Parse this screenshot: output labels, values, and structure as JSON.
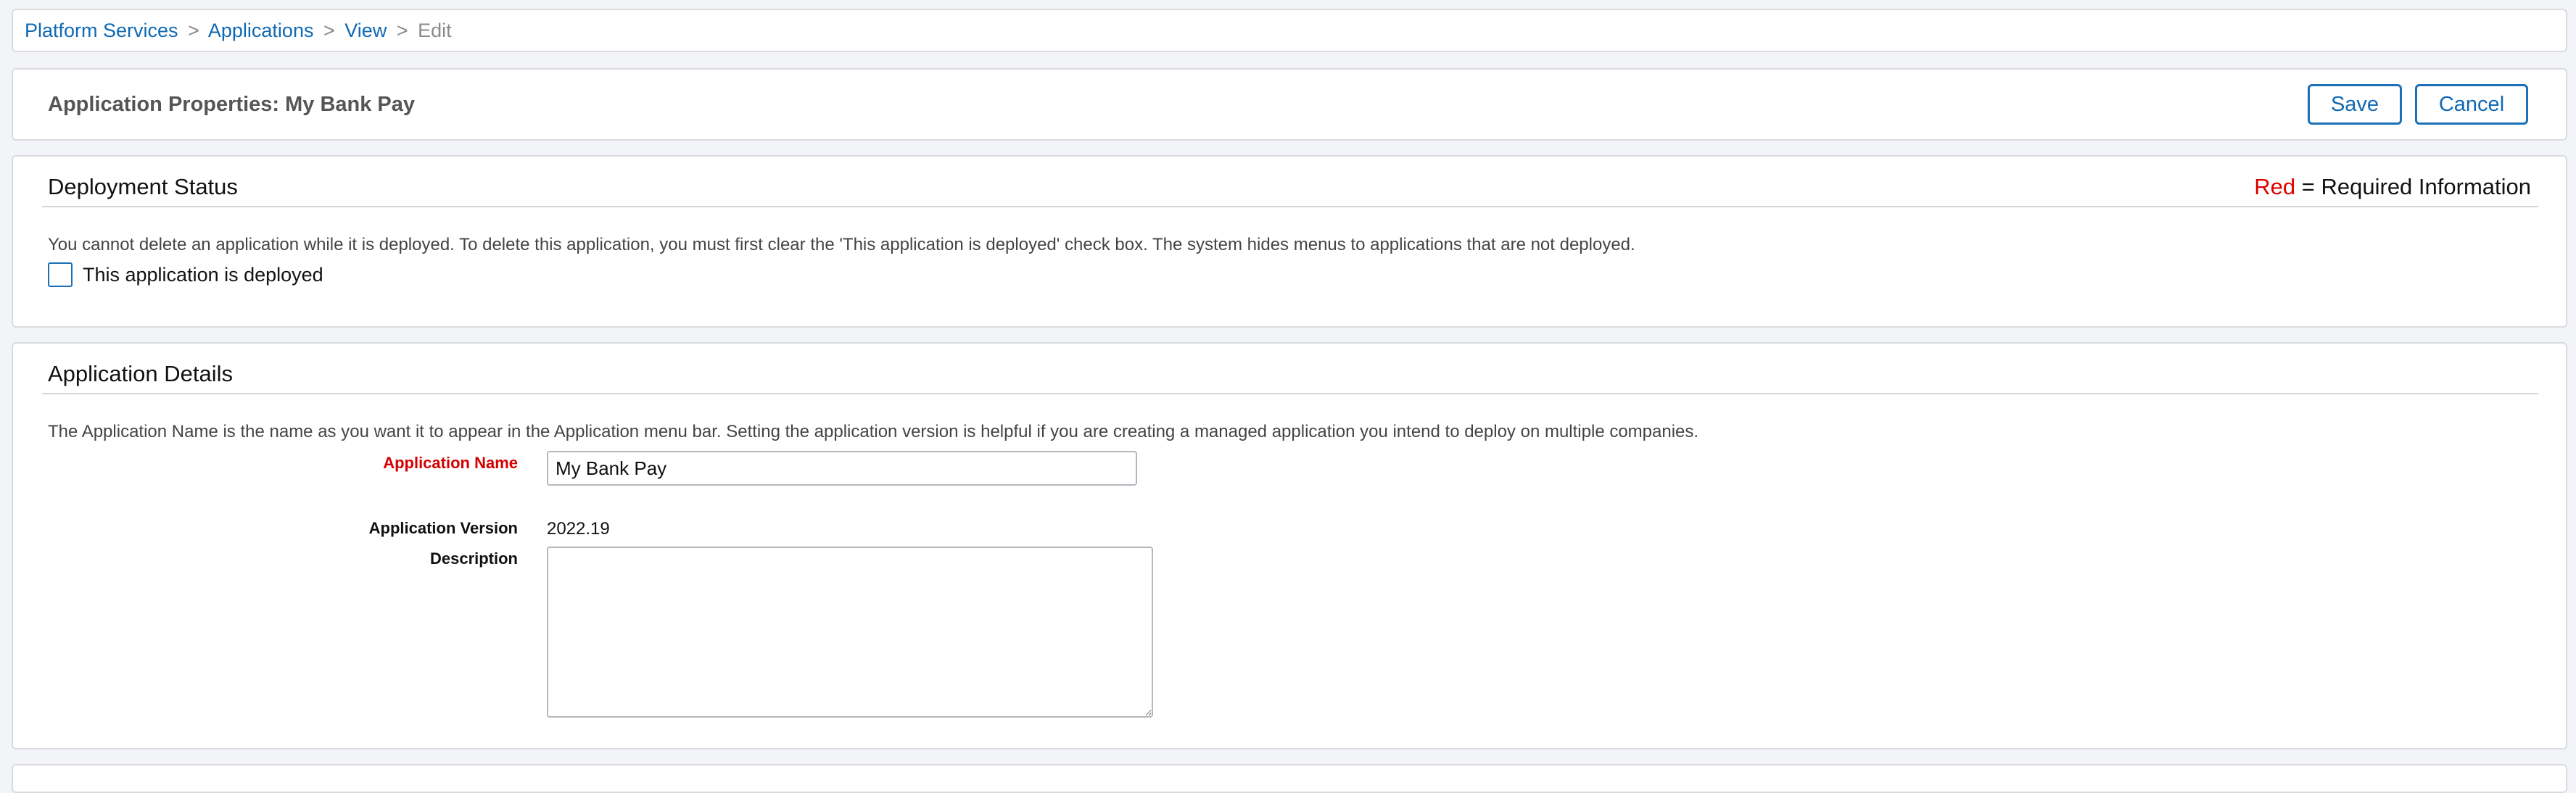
{
  "breadcrumb": {
    "items": [
      "Platform Services",
      "Applications",
      "View"
    ],
    "separator": ">",
    "current": "Edit"
  },
  "header": {
    "title": "Application Properties: My Bank Pay",
    "save_label": "Save",
    "cancel_label": "Cancel"
  },
  "deployment": {
    "title": "Deployment Status",
    "required_note_red": "Red",
    "required_note_rest": " = Required Information",
    "help_text": "You cannot delete an application while it is deployed. To delete this application, you must first clear the 'This application is deployed' check box. The system hides menus to applications that are not deployed.",
    "checkbox_label": "This application is deployed",
    "checkbox_checked": false
  },
  "details": {
    "title": "Application Details",
    "help_text": "The Application Name is the name as you want it to appear in the Application menu bar. Setting the application version is helpful if you are creating a managed application you intend to deploy on multiple companies.",
    "name_label": "Application Name",
    "name_value": "My Bank Pay",
    "version_label": "Application Version",
    "version_value": "2022.19",
    "description_label": "Description",
    "description_value": ""
  },
  "colors": {
    "link": "#1069b3",
    "required": "#e00000",
    "border": "#d9dbe0"
  }
}
